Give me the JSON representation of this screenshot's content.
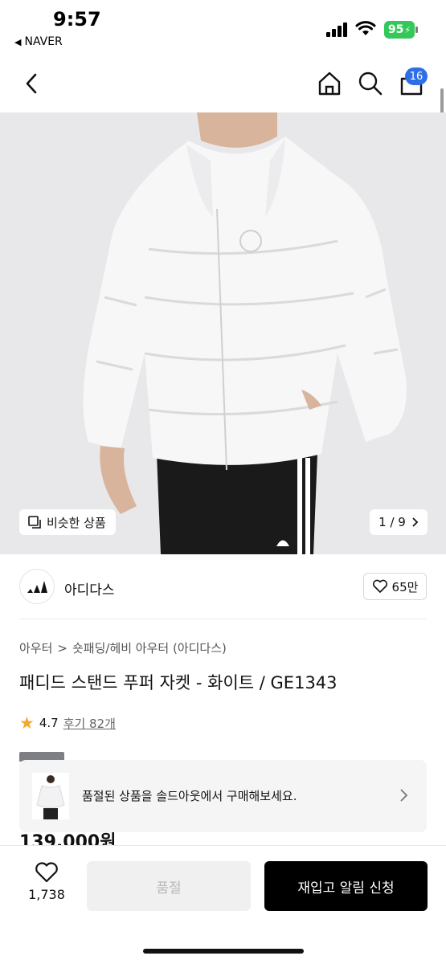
{
  "status_bar": {
    "time": "9:57",
    "back_app": "NAVER",
    "battery": "95"
  },
  "nav": {
    "cart_count": "16",
    "icons": [
      "back-chevron-icon",
      "home-icon",
      "search-icon",
      "cart-icon"
    ]
  },
  "gallery": {
    "similar_label": "비슷한 상품",
    "current_page": "1",
    "total_pages": "9",
    "pager_text": "1 / 9"
  },
  "brand": {
    "name": "아디다스",
    "like_count": "65만"
  },
  "breadcrumb": {
    "items": [
      "아우터",
      "숏패딩/헤비 아우터 (아디다스)"
    ],
    "separator": ">"
  },
  "product": {
    "title": "패디드 스탠드 푸퍼 자켓 - 화이트 / GE1343",
    "rating": "4.7",
    "reviews_label": "후기 82개",
    "price": "139,000원"
  },
  "soldout_card": {
    "message": "품절된 상품을 솔드아웃에서 구매해보세요."
  },
  "bottom_bar": {
    "wish_count": "1,738",
    "soldout_label": "품절",
    "restock_label": "재입고 알림 신청"
  },
  "colors": {
    "accent_blue": "#2f6fe6",
    "battery_green": "#34c759",
    "star": "#f2a92c",
    "primary_button": "#000000"
  }
}
